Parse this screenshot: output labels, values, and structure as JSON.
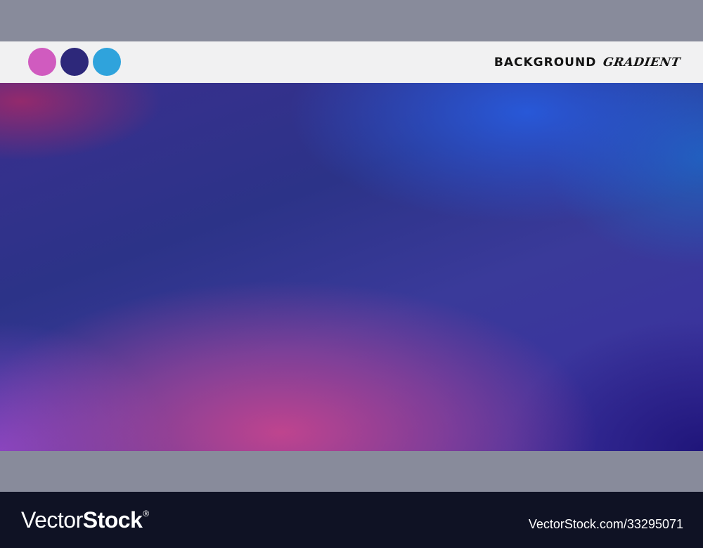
{
  "header": {
    "title_main": "BACKGROUND",
    "title_accent": "GRADIENT",
    "swatches": [
      {
        "name": "pink",
        "color": "#d05bbf"
      },
      {
        "name": "navy",
        "color": "#2d287a"
      },
      {
        "name": "blue",
        "color": "#2fa3dc"
      }
    ]
  },
  "colors": {
    "band": "#888b9b",
    "header_bg": "#f1f1f2",
    "footer_bg": "#0f1224"
  },
  "footer": {
    "logo_light": "Vector",
    "logo_bold": "Stock",
    "logo_mark": "®",
    "stock_id": "VectorStock.com/33295071"
  }
}
